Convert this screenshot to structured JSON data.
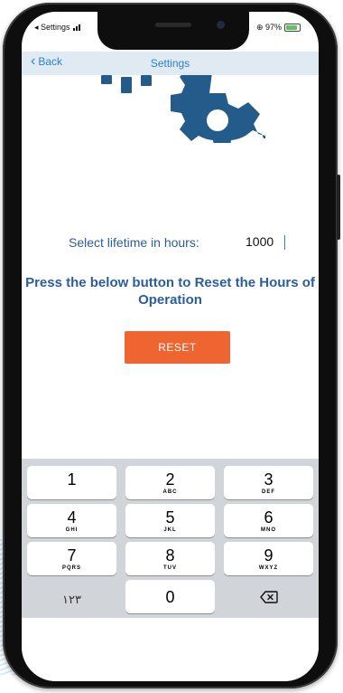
{
  "status_bar": {
    "back_app": "◂ Settings",
    "battery": "⊕ 97%"
  },
  "nav": {
    "back_label": "Back",
    "title": "Settings"
  },
  "form": {
    "lifetime_label": "Select lifetime in hours:",
    "lifetime_value": "1000",
    "reset_info": "Press the below button to Reset the Hours of Operation",
    "reset_button": "RESET"
  },
  "keypad": {
    "keys": [
      {
        "digit": "1",
        "letters": ""
      },
      {
        "digit": "2",
        "letters": "ABC"
      },
      {
        "digit": "3",
        "letters": "DEF"
      },
      {
        "digit": "4",
        "letters": "GHI"
      },
      {
        "digit": "5",
        "letters": "JKL"
      },
      {
        "digit": "6",
        "letters": "MNO"
      },
      {
        "digit": "7",
        "letters": "PQRS"
      },
      {
        "digit": "8",
        "letters": "TUV"
      },
      {
        "digit": "9",
        "letters": "WXYZ"
      }
    ],
    "switch_label": "١٢٣",
    "zero": "0"
  },
  "colors": {
    "accent": "#2f7fd0",
    "text": "#2b5d9e",
    "reset": "#ef6532",
    "gear": "#235c8a"
  }
}
